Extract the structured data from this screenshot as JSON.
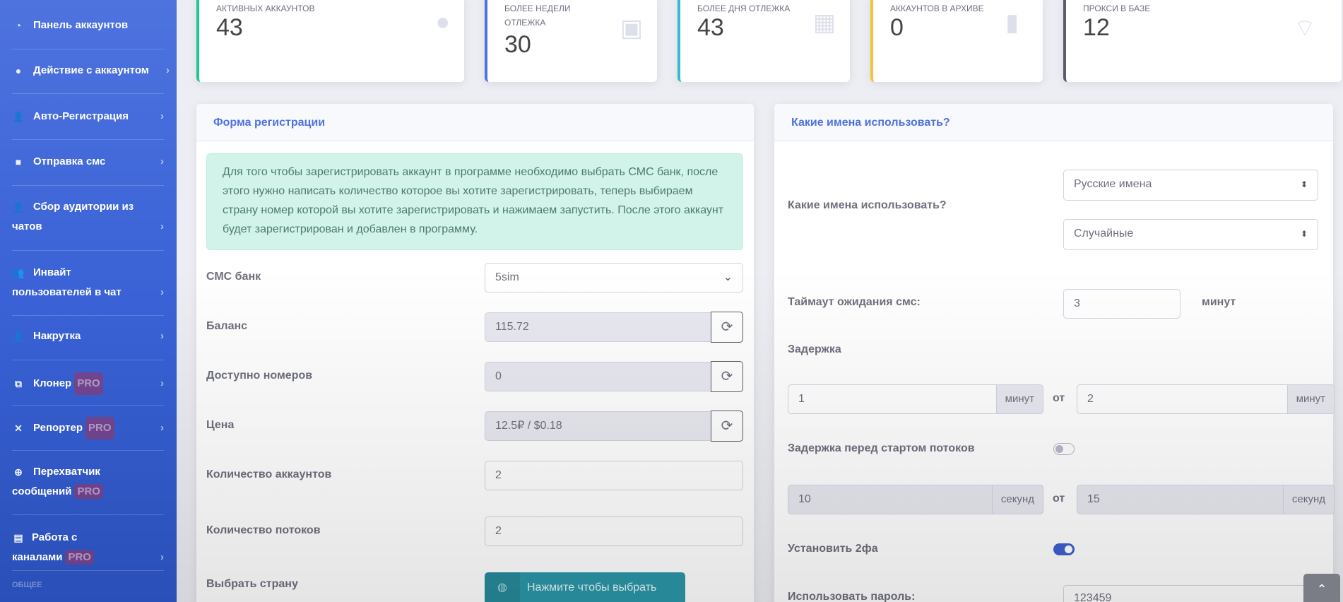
{
  "sidebar": {
    "items": [
      {
        "label": "Панель аккаунтов",
        "icon": "tachometer-icon"
      },
      {
        "label": "Действие с аккаунтом",
        "icon": "chevron-circle-icon"
      },
      {
        "label": "Авто-Регистрация",
        "icon": "user-plus-icon"
      },
      {
        "label": "Отправка смс",
        "icon": "comment-icon"
      },
      {
        "label": "Сбор аудитории из чатов",
        "icon": "user-gear-icon"
      },
      {
        "label": "Инвайт пользователей в чат",
        "icon": "users-icon"
      },
      {
        "label": "Накрутка",
        "icon": "user-gear-icon"
      },
      {
        "label": "Клонер",
        "icon": "sitemap-icon",
        "badge": "PRO"
      },
      {
        "label": "Репортер",
        "icon": "user-slash-icon",
        "badge": "PRO"
      },
      {
        "label": "Перехватчик сообщений",
        "icon": "crosshairs-icon",
        "badge": "PRO"
      },
      {
        "label": "Работа с каналами",
        "icon": "list-icon",
        "badge": "PRO"
      }
    ],
    "section_heading": "ОБЩЕЕ"
  },
  "stats": [
    {
      "label": "Активных аккаунтов",
      "value": "43",
      "color": "#1cc88a",
      "icon": "user-icon"
    },
    {
      "label": "Более недели отлежка",
      "value": "30",
      "color": "#4e73df",
      "icon": "calendar-check-icon"
    },
    {
      "label": "Более дня отлежка",
      "value": "43",
      "color": "#36b9cc",
      "icon": "calendar-icon"
    },
    {
      "label": "Аккаунтов в архиве",
      "value": "0",
      "color": "#f6c23e",
      "icon": "file-archive-icon"
    },
    {
      "label": "Прокси в базе",
      "value": "12",
      "color": "#5a5c69",
      "icon": "wifi-icon"
    }
  ],
  "reg_form": {
    "title": "Форма регистрации",
    "info": "Для того чтобы зарегистрировать аккаунт в программе необходимо выбрать СМС банк, после этого нужно написать количество которое вы хотите зарегистрировать, теперь выбираем страну номер которой вы хотите зарегистрировать и нажимаем запустить. После этого аккаунт будет зарегистрирован и добавлен в программу.",
    "sms_bank_label": "СМС банк",
    "sms_bank_value": "5sim",
    "balance_label": "Баланс",
    "balance_value": "115.72",
    "available_label": "Доступно номеров",
    "available_value": "0",
    "price_label": "Цена",
    "price_value": "12.5₽ / $0.18",
    "accounts_label": "Количество аккаунтов",
    "accounts_value": "2",
    "threads_label": "Количество потоков",
    "threads_value": "2",
    "country_label": "Выбрать страну",
    "country_button": "Нажмите чтобы выбрать"
  },
  "names_form": {
    "title": "Какие имена использовать?",
    "names_label": "Какие имена использовать?",
    "names_select_1": "Русские имена",
    "names_select_2": "Случайные",
    "timeout_label": "Таймаут ожидания смс:",
    "timeout_value": "3",
    "timeout_unit": "минут",
    "delay_label": "Задержка",
    "delay_from": "1",
    "delay_to": "2",
    "delay_unit": "минут",
    "between": "от",
    "thread_delay_label": "Задержка перед стартом потоков",
    "thread_delay_enabled": false,
    "thread_from": "10",
    "thread_to": "15",
    "thread_unit": "секунд",
    "twofa_label": "Установить 2фа",
    "twofa_enabled": true,
    "password_label": "Использовать пароль:",
    "password_value": "123459"
  }
}
